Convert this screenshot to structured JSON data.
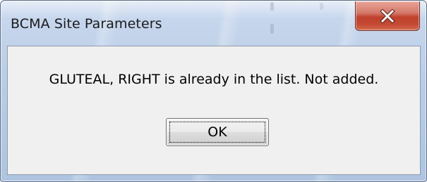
{
  "window": {
    "title": "BCMA Site Parameters",
    "close_icon": "close-x-icon"
  },
  "dialog": {
    "message": "GLUTEAL, RIGHT is already in the list. Not added.",
    "ok_label": "OK"
  },
  "colors": {
    "frame": "#b9cde6",
    "close_button": "#c1402b",
    "client_background": "#f0f0f0"
  }
}
